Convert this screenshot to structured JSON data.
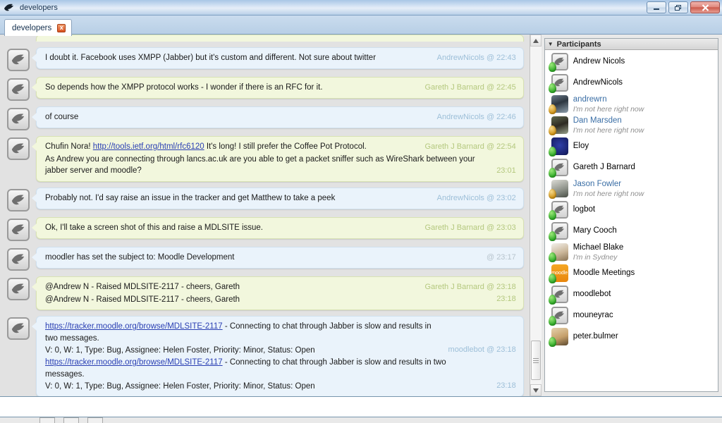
{
  "window": {
    "title": "developers",
    "app_icon": "swallow-bird-icon",
    "buttons": {
      "minimize": "Minimize",
      "maximize": "Restore",
      "close": "Close"
    }
  },
  "tab": {
    "label": "developers",
    "close_label": "x"
  },
  "participants_panel": {
    "title": "Participants",
    "caret": "▼",
    "items": [
      {
        "name": "Andrew Nicols",
        "status_text": "",
        "presence": "online",
        "avatar": "default-bird-avatar",
        "name_is_link": false
      },
      {
        "name": "AndrewNicols",
        "status_text": "",
        "presence": "online",
        "avatar": "default-bird-avatar",
        "name_is_link": false
      },
      {
        "name": "andrewrn",
        "status_text": "I'm not here right now",
        "presence": "away",
        "avatar": "photo-snow-hat",
        "name_is_link": true
      },
      {
        "name": "Dan Marsden",
        "status_text": "I'm not here right now",
        "presence": "away",
        "avatar": "photo-cap-man",
        "name_is_link": true
      },
      {
        "name": "Eloy",
        "status_text": "",
        "presence": "online",
        "avatar": "grover-muppet",
        "name_is_link": false
      },
      {
        "name": "Gareth J Barnard",
        "status_text": "",
        "presence": "online",
        "avatar": "default-bird-avatar",
        "name_is_link": false
      },
      {
        "name": "Jason Fowler",
        "status_text": "I'm not here right now",
        "presence": "away",
        "avatar": "photo-polar-bear",
        "name_is_link": true
      },
      {
        "name": "logbot",
        "status_text": "",
        "presence": "online",
        "avatar": "default-bird-avatar",
        "name_is_link": false
      },
      {
        "name": "Mary Cooch",
        "status_text": "",
        "presence": "online",
        "avatar": "default-bird-avatar",
        "name_is_link": false
      },
      {
        "name": "Michael Blake",
        "status_text": "I'm in Sydney",
        "presence": "online",
        "avatar": "photo-kangaroo",
        "name_is_link": false
      },
      {
        "name": "Moodle Meetings",
        "status_text": "",
        "presence": "online",
        "avatar": "moodle-logo-orange",
        "name_is_link": false
      },
      {
        "name": "moodlebot",
        "status_text": "",
        "presence": "online",
        "avatar": "default-bird-avatar",
        "name_is_link": false
      },
      {
        "name": "mouneyrac",
        "status_text": "",
        "presence": "online",
        "avatar": "default-bird-avatar",
        "name_is_link": false
      },
      {
        "name": "peter.bulmer",
        "status_text": "",
        "presence": "online",
        "avatar": "photo-dog",
        "name_is_link": false
      }
    ]
  },
  "chat": {
    "clipped_top_bubble": {
      "color": "green"
    },
    "messages": [
      {
        "color": "blue",
        "avatar": "default-bird-avatar",
        "lines": [
          {
            "parts": [
              {
                "type": "text",
                "value": "I doubt it. Facebook uses XMPP (Jabber) but it's custom and different. Not sure about twitter"
              }
            ],
            "meta": "AndrewNicols @ 22:43",
            "meta_style": "blue-meta"
          }
        ]
      },
      {
        "color": "green",
        "avatar": "default-bird-avatar",
        "lines": [
          {
            "parts": [
              {
                "type": "text",
                "value": "So depends how the XMPP protocol works - I wonder if there is an RFC for it."
              }
            ],
            "meta": "Gareth J Barnard @ 22:45",
            "meta_style": "green-meta"
          }
        ]
      },
      {
        "color": "blue",
        "avatar": "default-bird-avatar",
        "lines": [
          {
            "parts": [
              {
                "type": "text",
                "value": "of course"
              }
            ],
            "meta": "AndrewNicols @ 22:46",
            "meta_style": "blue-meta"
          }
        ]
      },
      {
        "color": "green",
        "avatar": "default-bird-avatar",
        "lines": [
          {
            "parts": [
              {
                "type": "text",
                "value": "Chufin Nora! "
              },
              {
                "type": "link",
                "value": "http://tools.ietf.org/html/rfc6120"
              },
              {
                "type": "text",
                "value": " It's long! I still prefer the Coffee Pot Protocol."
              }
            ],
            "meta": "Gareth J Barnard @ 22:54",
            "meta_style": "green-meta"
          },
          {
            "parts": [
              {
                "type": "text",
                "value": "As Andrew you are connecting through lancs.ac.uk are you able to get a packet sniffer such as WireShark between your jabber server and moodle?"
              }
            ],
            "meta": "23:01",
            "meta_style": "green-meta"
          }
        ]
      },
      {
        "color": "blue",
        "avatar": "default-bird-avatar",
        "lines": [
          {
            "parts": [
              {
                "type": "text",
                "value": "Probably not. I'd say raise an issue in the tracker and get Matthew to take a peek"
              }
            ],
            "meta": "AndrewNicols @ 23:02",
            "meta_style": "blue-meta"
          }
        ]
      },
      {
        "color": "green",
        "avatar": "default-bird-avatar",
        "lines": [
          {
            "parts": [
              {
                "type": "text",
                "value": "Ok, I'll take a screen shot of this and raise a MDLSITE issue."
              }
            ],
            "meta": "Gareth J Barnard @ 23:03",
            "meta_style": "green-meta"
          }
        ]
      },
      {
        "color": "blue",
        "avatar": "default-bird-avatar",
        "lines": [
          {
            "parts": [
              {
                "type": "text",
                "value": "moodler has set the subject to: Moodle Development"
              }
            ],
            "meta": "@ 23:17",
            "meta_style": "grey-meta"
          }
        ]
      },
      {
        "color": "green",
        "avatar": "default-bird-avatar",
        "lines": [
          {
            "parts": [
              {
                "type": "text",
                "value": "@Andrew N - Raised MDLSITE-2117 - cheers, Gareth"
              }
            ],
            "meta": "Gareth J Barnard @ 23:18",
            "meta_style": "green-meta"
          },
          {
            "parts": [
              {
                "type": "text",
                "value": "@Andrew N - Raised MDLSITE-2117 - cheers, Gareth"
              }
            ],
            "meta": "23:18",
            "meta_style": "green-meta"
          }
        ]
      },
      {
        "color": "blue",
        "avatar": "default-bird-avatar",
        "lines": [
          {
            "parts": [
              {
                "type": "link",
                "value": "https://tracker.moodle.org/browse/MDLSITE-2117"
              },
              {
                "type": "text",
                "value": " - Connecting to chat through Jabber is slow and results in two messages."
              }
            ],
            "sub": "V: 0, W: 1, Type: Bug, Assignee: Helen Foster, Priority: Minor, Status: Open",
            "meta": "moodlebot @ 23:18",
            "meta_style": "blue-meta"
          },
          {
            "parts": [
              {
                "type": "link",
                "value": "https://tracker.moodle.org/browse/MDLSITE-2117"
              },
              {
                "type": "text",
                "value": " - Connecting to chat through Jabber is slow and results in two messages."
              }
            ],
            "sub": "V: 0, W: 1, Type: Bug, Assignee: Helen Foster, Priority: Minor, Status: Open",
            "meta": "23:18",
            "meta_style": "blue-meta"
          }
        ]
      }
    ]
  },
  "composer": {
    "value": "",
    "placeholder": ""
  },
  "colors": {
    "bubble_incoming": "#eaf3fb",
    "bubble_outgoing": "#f2f7dd",
    "link": "#2a3fb3",
    "titlebar": "#b9d0e8",
    "status_online": "#2faa27",
    "status_away": "#cf9316"
  }
}
